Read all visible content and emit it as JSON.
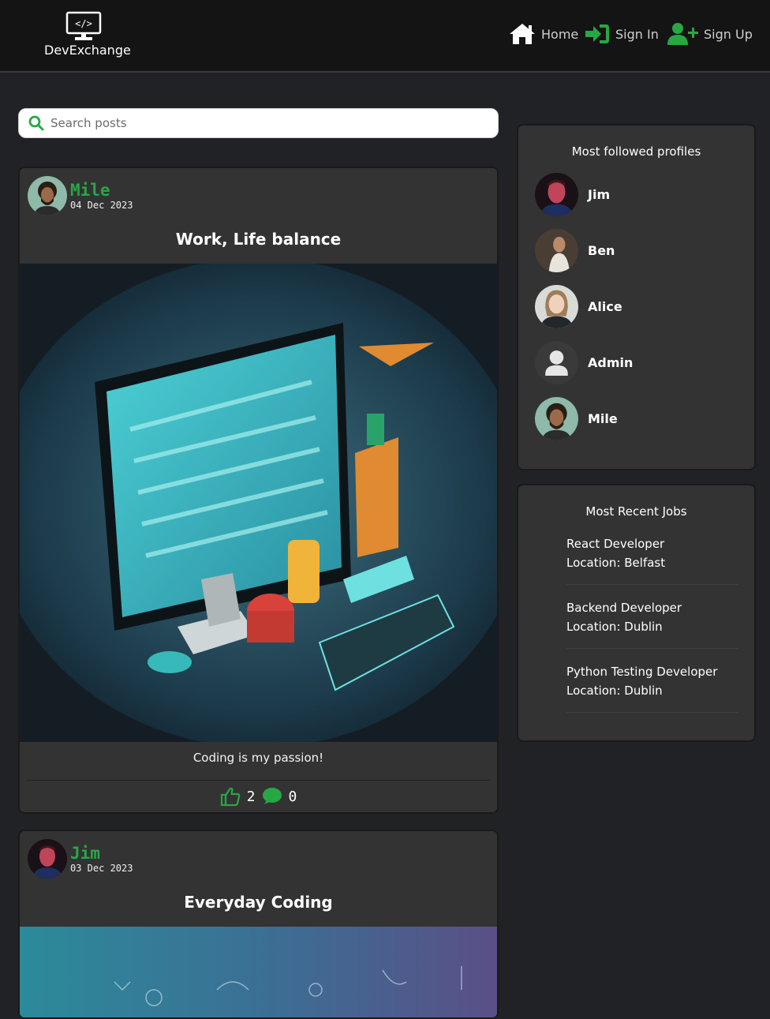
{
  "navbar": {
    "brand_name": "DevExchange",
    "links": [
      {
        "label": "Home",
        "icon": "home-icon"
      },
      {
        "label": "Sign In",
        "icon": "sign-in-icon"
      },
      {
        "label": "Sign Up",
        "icon": "user-plus-icon"
      }
    ]
  },
  "search": {
    "placeholder": "Search posts"
  },
  "posts": [
    {
      "author": "Mile",
      "date": "04 Dec 2023",
      "title": "Work, Life balance",
      "content": "Coding is my passion!",
      "likes": "2",
      "comments": "0"
    },
    {
      "author": "Jim",
      "date": "03 Dec 2023",
      "title": "Everyday Coding"
    }
  ],
  "profiles_panel": {
    "title": "Most followed profiles",
    "profiles": [
      {
        "name": "Jim"
      },
      {
        "name": "Ben"
      },
      {
        "name": "Alice"
      },
      {
        "name": "Admin"
      },
      {
        "name": "Mile"
      }
    ]
  },
  "jobs_panel": {
    "title": "Most Recent Jobs",
    "jobs": [
      {
        "title": "React Developer",
        "location": "Location: Belfast"
      },
      {
        "title": "Backend Developer",
        "location": "Location: Dublin"
      },
      {
        "title": "Python Testing Developer",
        "location": "Location: Dublin"
      }
    ]
  },
  "colors": {
    "accent": "#28a745",
    "background": "#212226",
    "card": "#333333",
    "navbar": "#141414"
  }
}
